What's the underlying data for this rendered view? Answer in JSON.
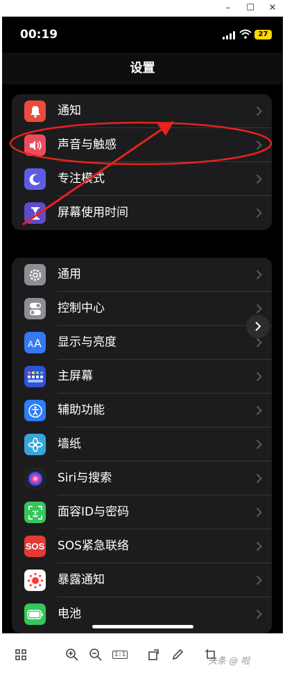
{
  "window": {
    "minimize": "–",
    "maximize": "☐",
    "close": "✕"
  },
  "status": {
    "time": "00:19",
    "battery": "27"
  },
  "nav": {
    "title": "设置"
  },
  "group1": [
    {
      "label": "通知",
      "icon": "notification-bell-icon",
      "color": "#eb4b3d"
    },
    {
      "label": "声音与触感",
      "icon": "speaker-icon",
      "color": "#eb4d5c"
    },
    {
      "label": "专注模式",
      "icon": "moon-icon",
      "color": "#5e5ce6"
    },
    {
      "label": "屏幕使用时间",
      "icon": "hourglass-icon",
      "color": "#5e4ccc"
    }
  ],
  "group2": [
    {
      "label": "通用",
      "icon": "gear-icon",
      "color": "#8e8e93"
    },
    {
      "label": "控制中心",
      "icon": "toggles-icon",
      "color": "#8e8e93"
    },
    {
      "label": "显示与亮度",
      "icon": "text-size-icon",
      "color": "#3478f6"
    },
    {
      "label": "主屏幕",
      "icon": "home-grid-icon",
      "color": "#3152d6"
    },
    {
      "label": "辅助功能",
      "icon": "accessibility-icon",
      "color": "#2f7df6"
    },
    {
      "label": "墙纸",
      "icon": "flower-icon",
      "color": "#37a6d8"
    },
    {
      "label": "Siri与搜索",
      "icon": "siri-icon",
      "color": "#222222"
    },
    {
      "label": "面容ID与密码",
      "icon": "face-id-icon",
      "color": "#34c759"
    },
    {
      "label": "SOS紧急联络",
      "icon": "sos-icon",
      "color": "#e53935",
      "text": "SOS"
    },
    {
      "label": "暴露通知",
      "icon": "exposure-icon",
      "color": "#ffffff"
    },
    {
      "label": "电池",
      "icon": "battery-icon",
      "color": "#34c759"
    }
  ],
  "toolbar": {
    "zoom_ratio": "1:1",
    "watermark": "头条 @ 啦"
  }
}
